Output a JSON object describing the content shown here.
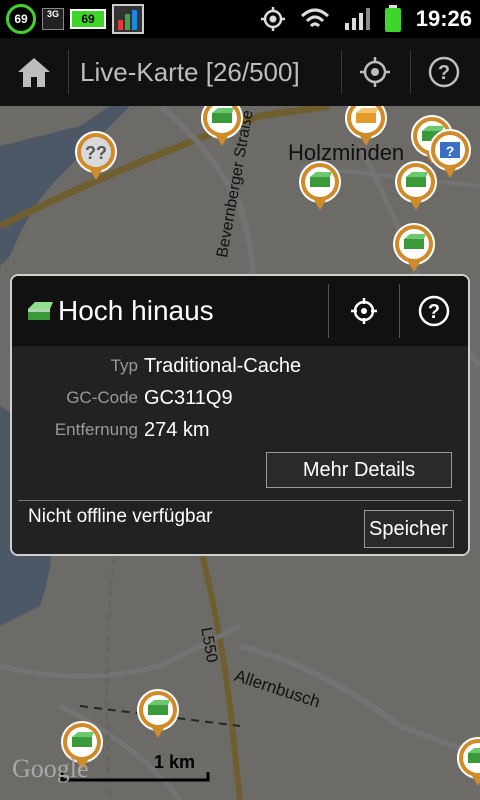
{
  "statusbar": {
    "battery_percent": "69",
    "network": "3G",
    "battery_widget": "69",
    "time": "19:26",
    "icons": [
      "gps-icon",
      "wifi-icon",
      "signal-icon",
      "battery-icon"
    ]
  },
  "actionbar": {
    "title": "Live-Karte [26/500]",
    "icons": [
      "home-icon",
      "locate-icon",
      "help-icon"
    ]
  },
  "map": {
    "labels": {
      "town": "Holzminden",
      "street1": "Bevernberger Straße",
      "street2": "L550",
      "street3": "Allernbusch"
    },
    "scale": "1 km",
    "attribution": "Google"
  },
  "popup": {
    "title": "Hoch hinaus",
    "rows": [
      {
        "label": "Typ",
        "value": "Traditional-Cache"
      },
      {
        "label": "GC-Code",
        "value": "GC311Q9"
      },
      {
        "label": "Entfernung",
        "value": "274 km"
      }
    ],
    "details_button": "Mehr Details",
    "offline_status": "Nicht offline verfügbar",
    "save_button": "Speicher"
  }
}
